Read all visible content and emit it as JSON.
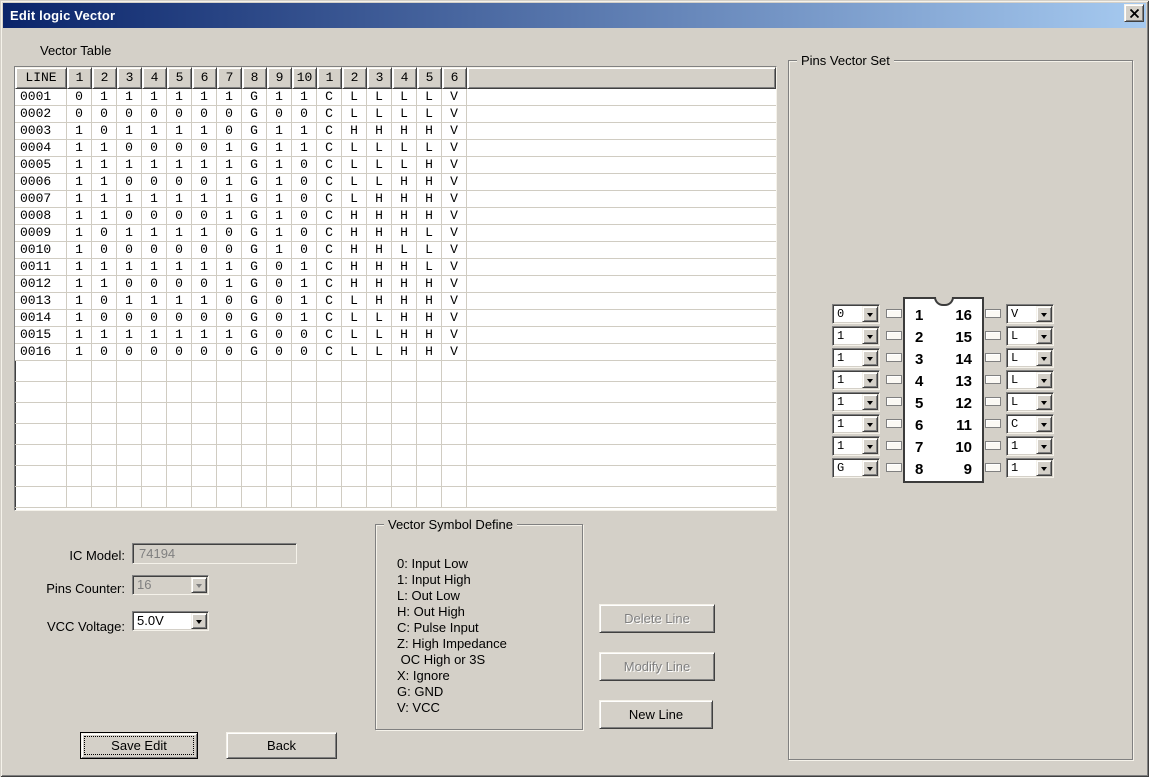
{
  "window": {
    "title": "Edit logic Vector"
  },
  "colors": {
    "titlebar_left": "#0a246a",
    "titlebar_right": "#a6caf0",
    "dialog_bg": "#d4d0c8",
    "grid_line": "#d0ccc2",
    "disabled_text": "#808080"
  },
  "vector_table": {
    "label": "Vector Table",
    "headers": [
      "LINE",
      "1",
      "2",
      "3",
      "4",
      "5",
      "6",
      "7",
      "8",
      "9",
      "10",
      "1",
      "2",
      "3",
      "4",
      "5",
      "6"
    ],
    "rows": [
      {
        "line": "0001",
        "cells": [
          "0",
          "1",
          "1",
          "1",
          "1",
          "1",
          "1",
          "G",
          "1",
          "1",
          "C",
          "L",
          "L",
          "L",
          "L",
          "V"
        ]
      },
      {
        "line": "0002",
        "cells": [
          "0",
          "0",
          "0",
          "0",
          "0",
          "0",
          "0",
          "G",
          "0",
          "0",
          "C",
          "L",
          "L",
          "L",
          "L",
          "V"
        ]
      },
      {
        "line": "0003",
        "cells": [
          "1",
          "0",
          "1",
          "1",
          "1",
          "1",
          "0",
          "G",
          "1",
          "1",
          "C",
          "H",
          "H",
          "H",
          "H",
          "V"
        ]
      },
      {
        "line": "0004",
        "cells": [
          "1",
          "1",
          "0",
          "0",
          "0",
          "0",
          "1",
          "G",
          "1",
          "1",
          "C",
          "L",
          "L",
          "L",
          "L",
          "V"
        ]
      },
      {
        "line": "0005",
        "cells": [
          "1",
          "1",
          "1",
          "1",
          "1",
          "1",
          "1",
          "G",
          "1",
          "0",
          "C",
          "L",
          "L",
          "L",
          "H",
          "V"
        ]
      },
      {
        "line": "0006",
        "cells": [
          "1",
          "1",
          "0",
          "0",
          "0",
          "0",
          "1",
          "G",
          "1",
          "0",
          "C",
          "L",
          "L",
          "H",
          "H",
          "V"
        ]
      },
      {
        "line": "0007",
        "cells": [
          "1",
          "1",
          "1",
          "1",
          "1",
          "1",
          "1",
          "G",
          "1",
          "0",
          "C",
          "L",
          "H",
          "H",
          "H",
          "V"
        ]
      },
      {
        "line": "0008",
        "cells": [
          "1",
          "1",
          "0",
          "0",
          "0",
          "0",
          "1",
          "G",
          "1",
          "0",
          "C",
          "H",
          "H",
          "H",
          "H",
          "V"
        ]
      },
      {
        "line": "0009",
        "cells": [
          "1",
          "0",
          "1",
          "1",
          "1",
          "1",
          "0",
          "G",
          "1",
          "0",
          "C",
          "H",
          "H",
          "H",
          "L",
          "V"
        ]
      },
      {
        "line": "0010",
        "cells": [
          "1",
          "0",
          "0",
          "0",
          "0",
          "0",
          "0",
          "G",
          "1",
          "0",
          "C",
          "H",
          "H",
          "L",
          "L",
          "V"
        ]
      },
      {
        "line": "0011",
        "cells": [
          "1",
          "1",
          "1",
          "1",
          "1",
          "1",
          "1",
          "G",
          "0",
          "1",
          "C",
          "H",
          "H",
          "H",
          "L",
          "V"
        ]
      },
      {
        "line": "0012",
        "cells": [
          "1",
          "1",
          "0",
          "0",
          "0",
          "0",
          "1",
          "G",
          "0",
          "1",
          "C",
          "H",
          "H",
          "H",
          "H",
          "V"
        ]
      },
      {
        "line": "0013",
        "cells": [
          "1",
          "0",
          "1",
          "1",
          "1",
          "1",
          "0",
          "G",
          "0",
          "1",
          "C",
          "L",
          "H",
          "H",
          "H",
          "V"
        ]
      },
      {
        "line": "0014",
        "cells": [
          "1",
          "0",
          "0",
          "0",
          "0",
          "0",
          "0",
          "G",
          "0",
          "1",
          "C",
          "L",
          "L",
          "H",
          "H",
          "V"
        ]
      },
      {
        "line": "0015",
        "cells": [
          "1",
          "1",
          "1",
          "1",
          "1",
          "1",
          "1",
          "G",
          "0",
          "0",
          "C",
          "L",
          "L",
          "H",
          "H",
          "V"
        ]
      },
      {
        "line": "0016",
        "cells": [
          "1",
          "0",
          "0",
          "0",
          "0",
          "0",
          "0",
          "G",
          "0",
          "0",
          "C",
          "L",
          "L",
          "H",
          "H",
          "V"
        ]
      }
    ]
  },
  "pins_vector_set": {
    "label": "Pins Vector Set",
    "left_pins": [
      {
        "pin": "1",
        "value": "0"
      },
      {
        "pin": "2",
        "value": "1"
      },
      {
        "pin": "3",
        "value": "1"
      },
      {
        "pin": "4",
        "value": "1"
      },
      {
        "pin": "5",
        "value": "1"
      },
      {
        "pin": "6",
        "value": "1"
      },
      {
        "pin": "7",
        "value": "1"
      },
      {
        "pin": "8",
        "value": "G"
      }
    ],
    "right_pins": [
      {
        "pin": "16",
        "value": "V"
      },
      {
        "pin": "15",
        "value": "L"
      },
      {
        "pin": "14",
        "value": "L"
      },
      {
        "pin": "13",
        "value": "L"
      },
      {
        "pin": "12",
        "value": "L"
      },
      {
        "pin": "11",
        "value": "C"
      },
      {
        "pin": "10",
        "value": "1"
      },
      {
        "pin": "9",
        "value": "1"
      }
    ]
  },
  "form": {
    "ic_model_label": "IC Model:",
    "ic_model_value": "74194",
    "pins_counter_label": "Pins Counter:",
    "pins_counter_value": "16",
    "vcc_voltage_label": "VCC Voltage:",
    "vcc_voltage_value": "5.0V"
  },
  "symbol_define": {
    "label": "Vector Symbol Define",
    "lines": [
      "0: Input Low",
      "1: Input High",
      "L: Out Low",
      "H: Out High",
      "C: Pulse Input",
      "Z: High Impedance",
      " OC High or 3S",
      "X: Ignore",
      "G: GND",
      "V: VCC"
    ]
  },
  "buttons": {
    "delete_line": "Delete Line",
    "modify_line": "Modify Line",
    "new_line": "New Line",
    "save_edit": "Save Edit",
    "back": "Back"
  }
}
